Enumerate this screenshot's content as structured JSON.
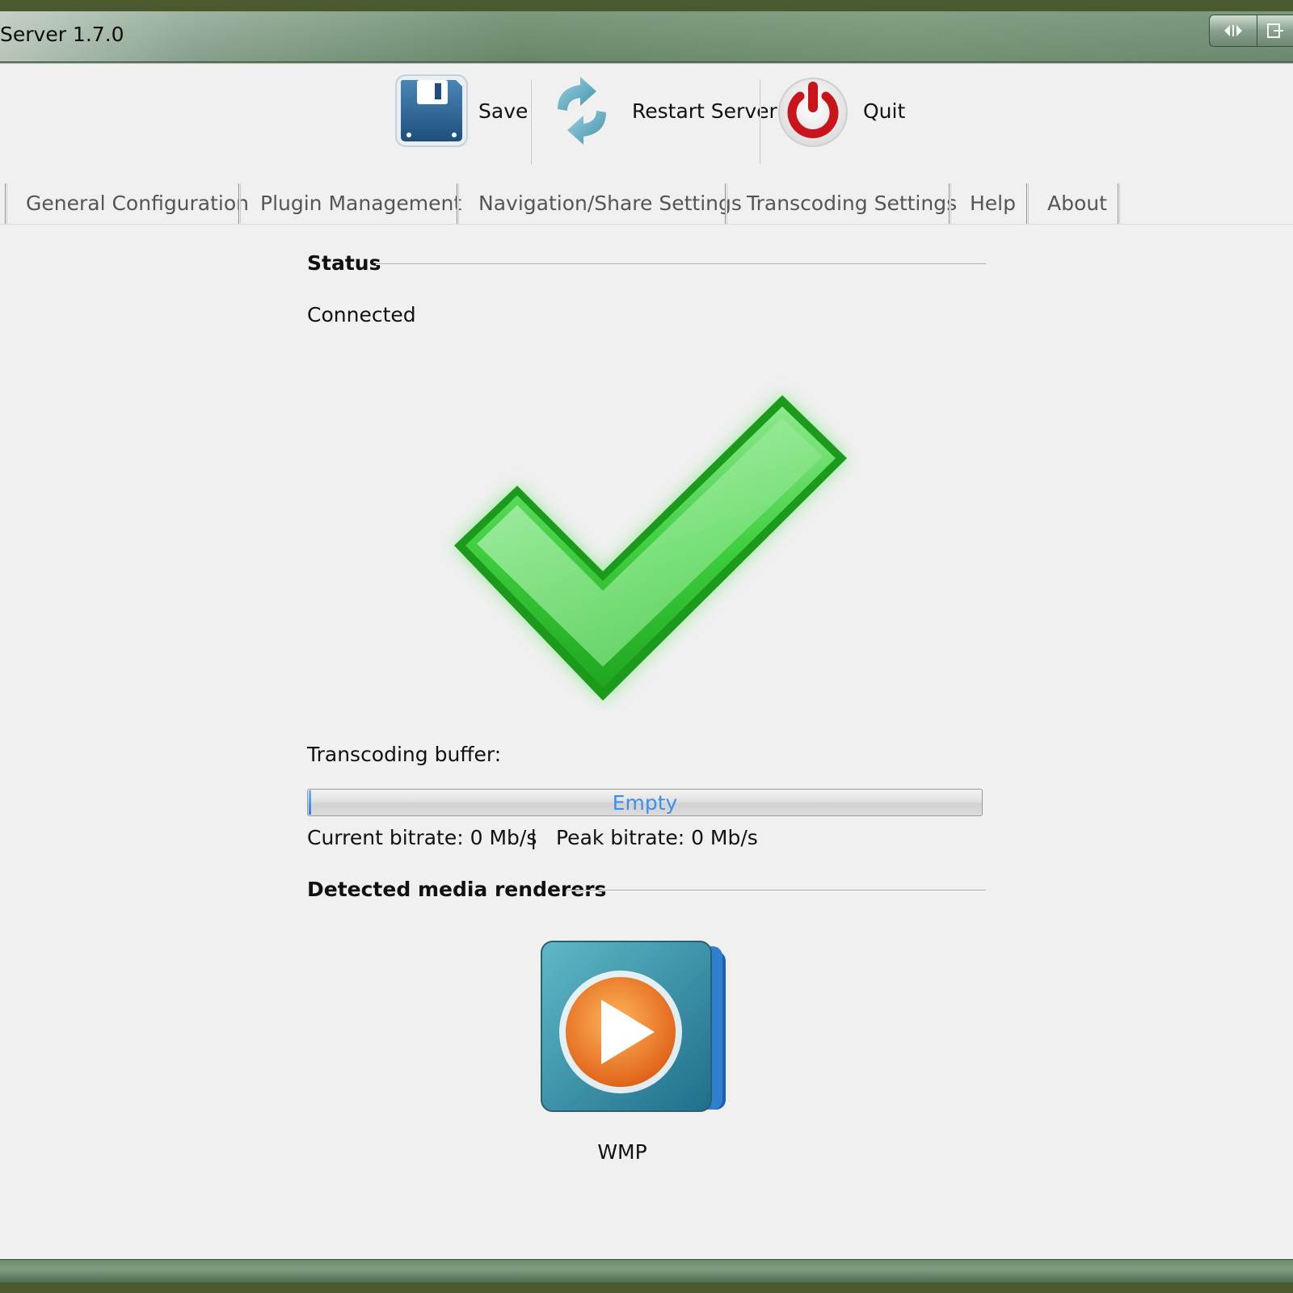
{
  "window": {
    "title": "Server 1.7.0",
    "controls": [
      "restore-icon",
      "exit-icon"
    ]
  },
  "toolbar": {
    "save_label": "Save",
    "restart_label": "Restart Server",
    "quit_label": "Quit"
  },
  "tabs": [
    {
      "label": "General Configuration"
    },
    {
      "label": "Plugin Management"
    },
    {
      "label": "Navigation/Share Settings"
    },
    {
      "label": "Transcoding Settings"
    },
    {
      "label": "Help"
    },
    {
      "label": "About"
    }
  ],
  "status": {
    "heading": "Status",
    "value": "Connected",
    "icon": "checkmark-icon"
  },
  "transcoding": {
    "label": "Transcoding buffer:",
    "buffer_text": "Empty",
    "buffer_fill_fraction": 0.0,
    "current_bitrate": "Current bitrate: 0 Mb/s",
    "separator": "|",
    "peak_bitrate": "Peak bitrate: 0 Mb/s"
  },
  "renderers": {
    "heading": "Detected media renderers",
    "items": [
      {
        "name": "WMP",
        "icon": "wmp-icon"
      }
    ]
  },
  "colors": {
    "client_bg": "#f0f0f0",
    "progress_text": "#3d8fe8",
    "check_green": "#2fc42f",
    "quit_red": "#c8141a",
    "save_blue": "#2a5f8f",
    "wmp_orange": "#f07a1c"
  }
}
